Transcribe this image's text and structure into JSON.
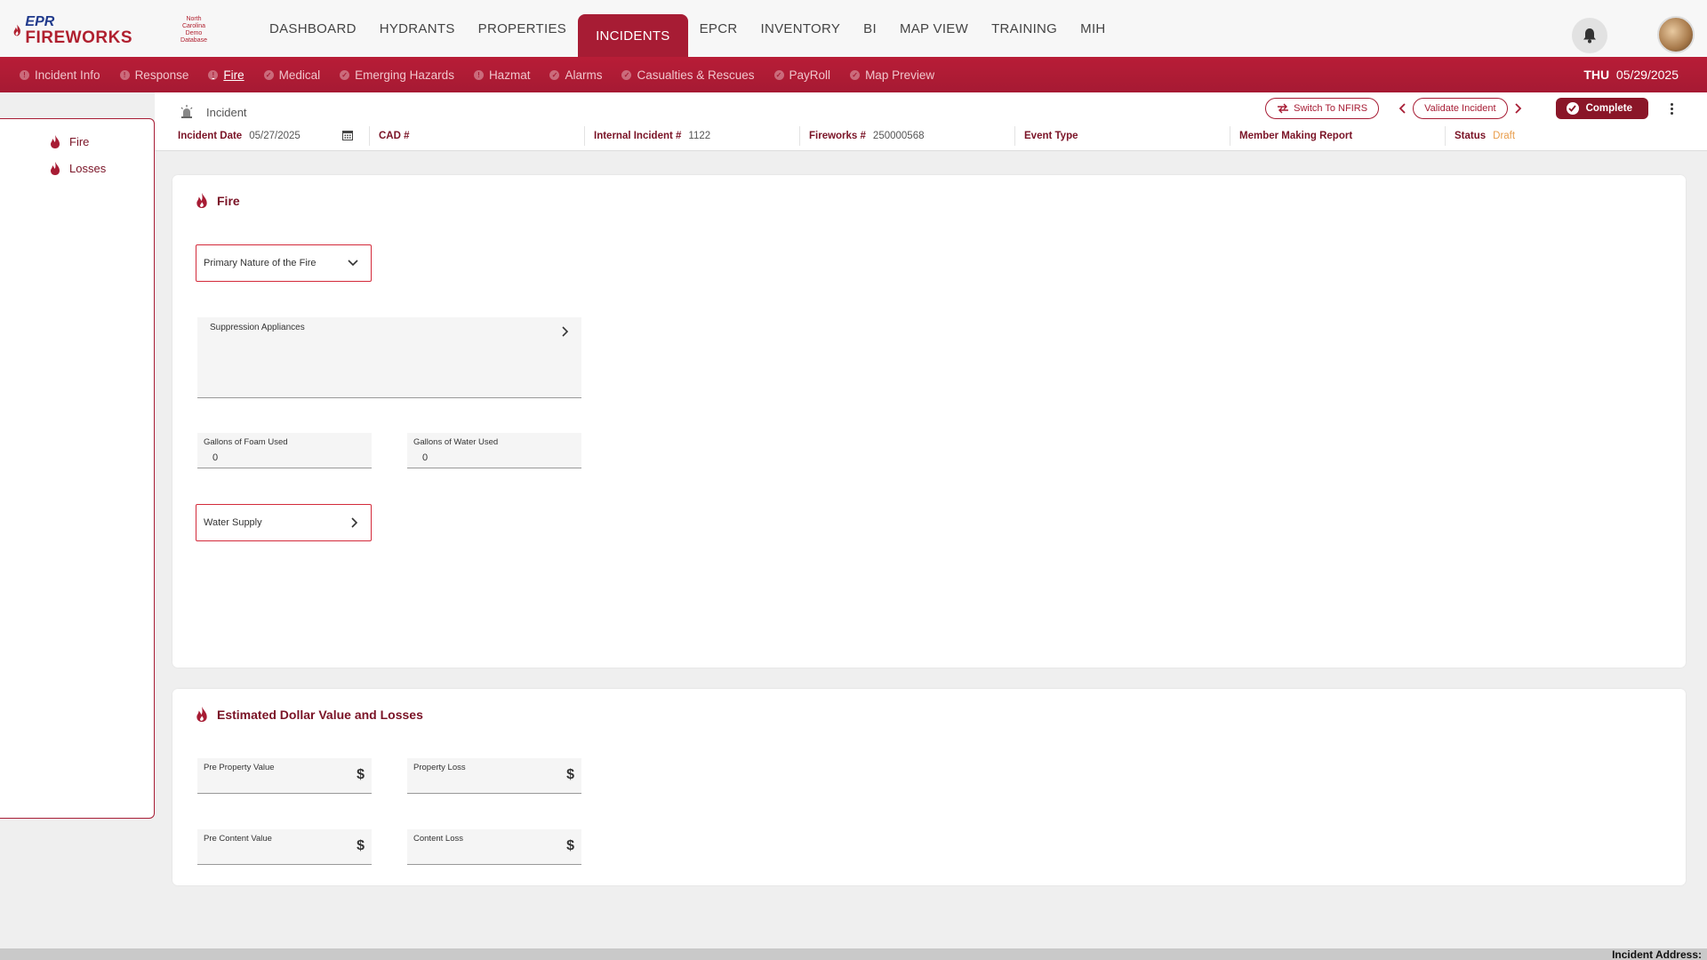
{
  "brand": {
    "line1": "EPR",
    "line2": "FIREWORKS"
  },
  "department": {
    "name_lines": [
      "North",
      "Carolina",
      "Demo",
      "Database"
    ]
  },
  "main_nav": [
    {
      "label": "DASHBOARD"
    },
    {
      "label": "HYDRANTS"
    },
    {
      "label": "PROPERTIES"
    },
    {
      "label": "INCIDENTS",
      "active": true
    },
    {
      "label": "EPCR"
    },
    {
      "label": "INVENTORY"
    },
    {
      "label": "BI"
    },
    {
      "label": "MAP VIEW"
    },
    {
      "label": "TRAINING"
    },
    {
      "label": "MIH"
    }
  ],
  "sub_nav": [
    {
      "label": "Incident Info",
      "status": "warning"
    },
    {
      "label": "Response",
      "status": "warning"
    },
    {
      "label": "Fire",
      "status": "warning",
      "active": true
    },
    {
      "label": "Medical",
      "status": "done"
    },
    {
      "label": "Emerging Hazards",
      "status": "done"
    },
    {
      "label": "Hazmat",
      "status": "warning"
    },
    {
      "label": "Alarms",
      "status": "done"
    },
    {
      "label": "Casualties & Rescues",
      "status": "done"
    },
    {
      "label": "PayRoll",
      "status": "done"
    },
    {
      "label": "Map Preview",
      "status": "done"
    }
  ],
  "header_date": {
    "day": "THU",
    "date": "05/29/2025"
  },
  "breadcrumb": "Incident",
  "actions": {
    "switch_label": "Switch To NFIRS",
    "validate_label": "Validate Incident",
    "complete_label": "Complete"
  },
  "incident_fields": {
    "incident_date": {
      "label": "Incident Date",
      "value": "05/27/2025"
    },
    "cad": {
      "label": "CAD #",
      "value": ""
    },
    "internal": {
      "label": "Internal Incident #",
      "value": "1122"
    },
    "fireworks": {
      "label": "Fireworks #",
      "value": "250000568"
    },
    "event_type": {
      "label": "Event Type",
      "value": ""
    },
    "member": {
      "label": "Member Making Report",
      "value": ""
    },
    "status": {
      "label": "Status",
      "value": "Draft"
    }
  },
  "left_nav": [
    {
      "label": "Fire"
    },
    {
      "label": "Losses"
    }
  ],
  "fire_section": {
    "title": "Fire",
    "primary_nature_label": "Primary Nature of the Fire",
    "suppression_label": "Suppression Appliances",
    "foam": {
      "label": "Gallons of Foam Used",
      "value": "0"
    },
    "water": {
      "label": "Gallons of Water Used",
      "value": "0"
    },
    "water_supply_label": "Water Supply"
  },
  "losses_section": {
    "title": "Estimated Dollar Value and Losses",
    "pre_property": {
      "label": "Pre Property Value",
      "symbol": "$"
    },
    "property_loss": {
      "label": "Property Loss",
      "symbol": "$"
    },
    "pre_content": {
      "label": "Pre Content Value",
      "symbol": "$"
    },
    "content_loss": {
      "label": "Content Loss",
      "symbol": "$"
    }
  },
  "footer": {
    "incident_address_label": "Incident Address:"
  },
  "colors": {
    "brand": "#a71c34",
    "dark": "#7a1326",
    "draft": "#e89c4a"
  }
}
